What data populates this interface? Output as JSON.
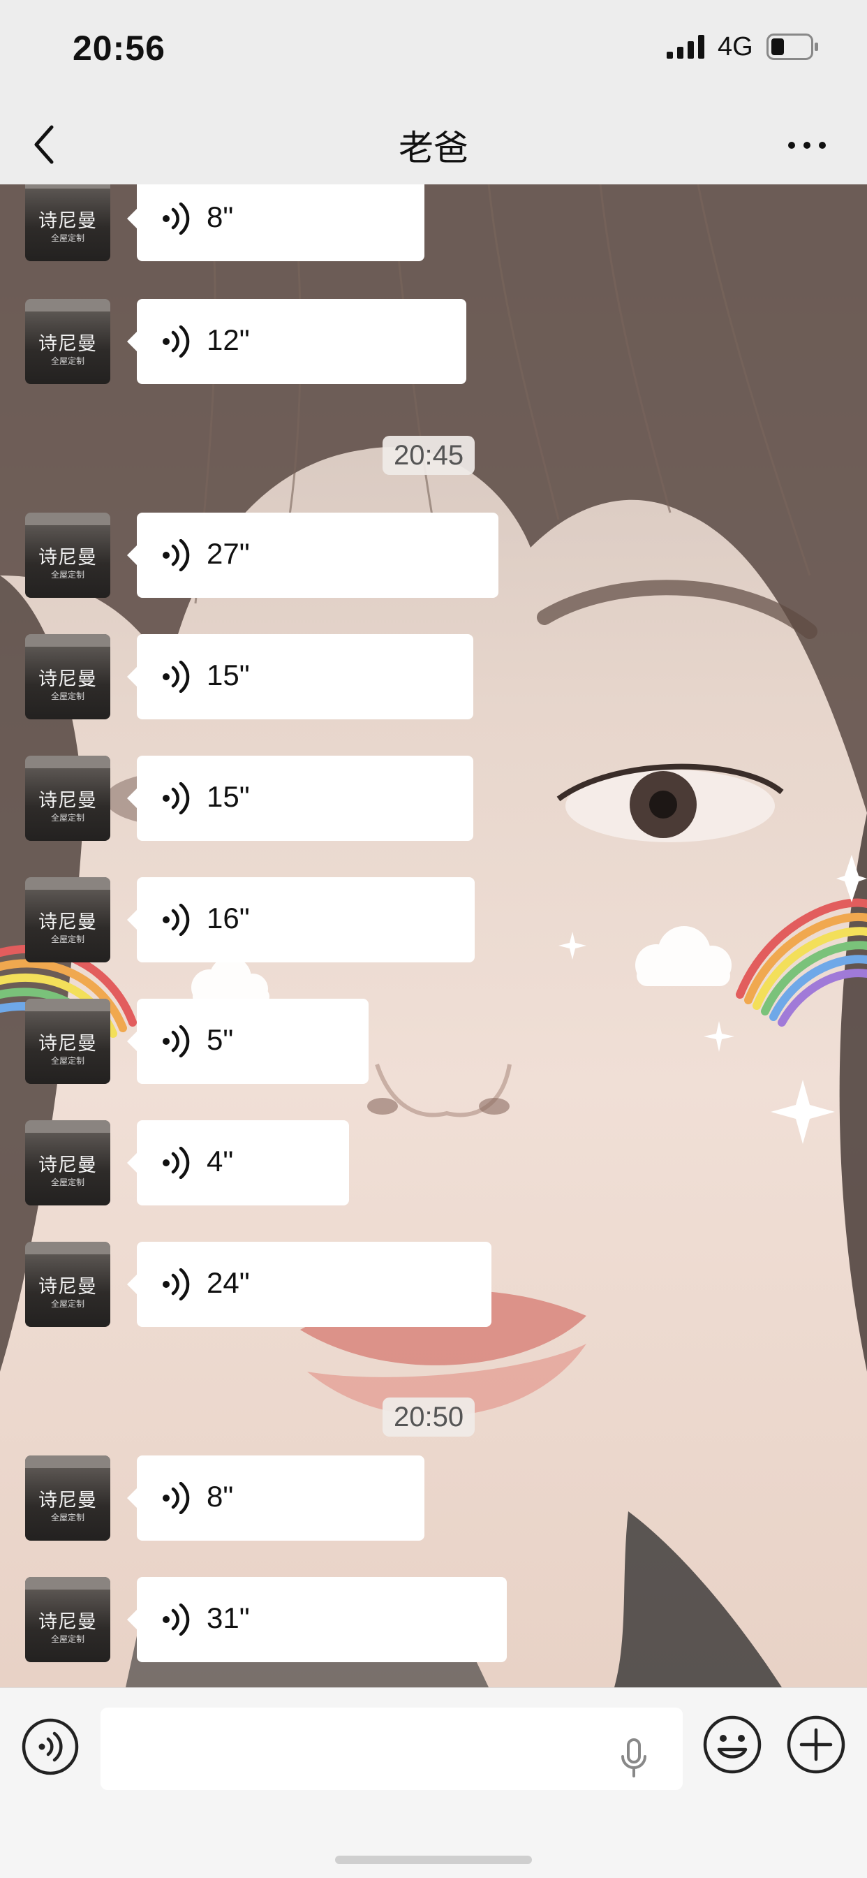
{
  "status_bar": {
    "time": "20:56",
    "network": "4G",
    "signal_icon": "cellular-signal-icon",
    "battery_icon": "battery-low-icon"
  },
  "nav": {
    "title": "老爸",
    "back_icon": "chevron-left-icon",
    "more_icon": "more-dots-icon"
  },
  "chat": {
    "timestamps": [
      "20:45",
      "20:50"
    ],
    "avatar_brand": "诗尼曼",
    "avatar_sub": "全屋定制",
    "messages": [
      {
        "duration": "8\""
      },
      {
        "duration": "12\""
      },
      {
        "duration": "27\""
      },
      {
        "duration": "15\""
      },
      {
        "duration": "15\""
      },
      {
        "duration": "16\""
      },
      {
        "duration": "5\""
      },
      {
        "duration": "4\""
      },
      {
        "duration": "24\""
      },
      {
        "duration": "8\""
      },
      {
        "duration": "31\""
      }
    ],
    "voice_icon": "voice-wave-icon"
  },
  "toolbar": {
    "voice_button_icon": "voice-input-icon",
    "input_value": "",
    "mic_icon": "microphone-icon",
    "emoji_icon": "emoji-smile-icon",
    "plus_icon": "plus-circle-icon"
  },
  "colors": {
    "bubble": "#ffffff",
    "bar_background": "#ededed",
    "toolbar_background": "#f5f5f5"
  }
}
